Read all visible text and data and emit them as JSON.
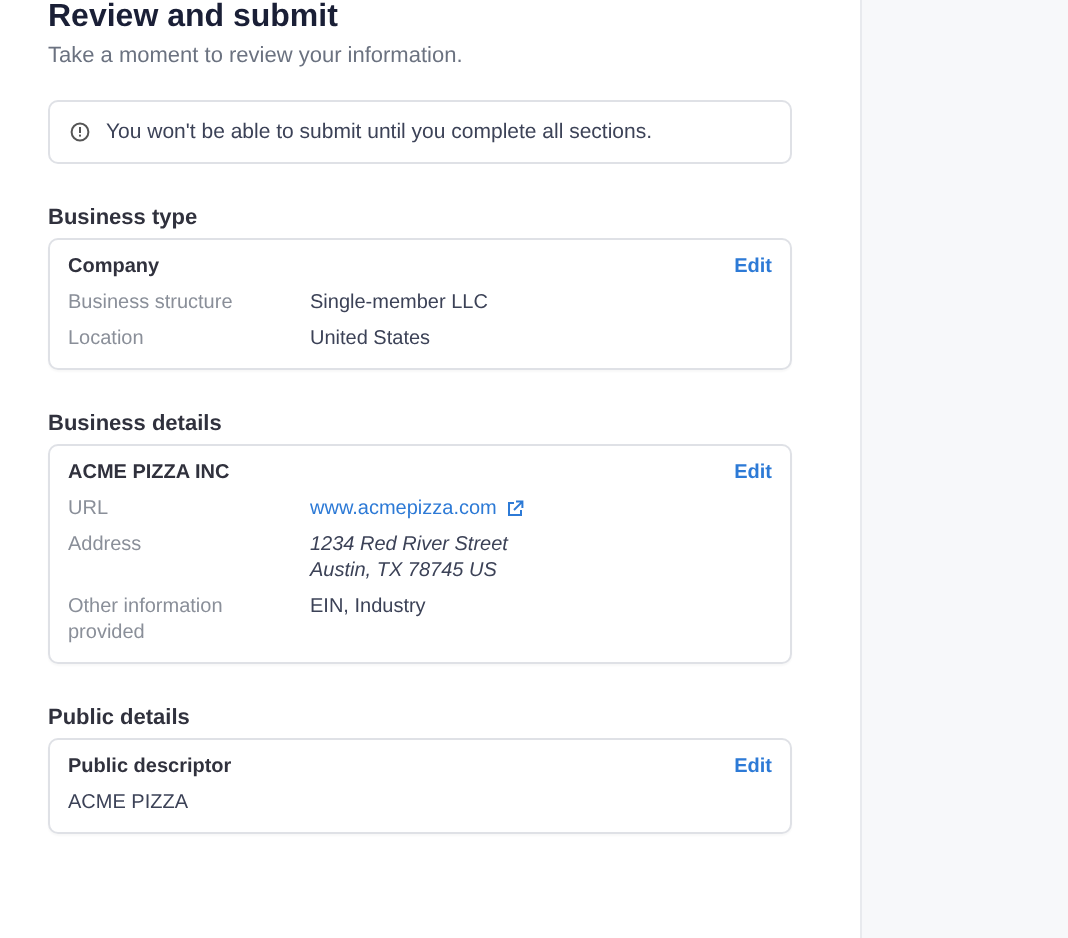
{
  "title": "Review and submit",
  "subtitle": "Take a moment to review your information.",
  "notice": {
    "text": "You won't be able to submit until you complete all sections."
  },
  "sections": [
    {
      "heading": "Business type",
      "card": {
        "title": "Company",
        "action": "Edit",
        "rows": [
          {
            "kind": "text",
            "label": "Business structure",
            "value": "Single-member LLC"
          },
          {
            "kind": "text",
            "label": "Location",
            "value": "United States"
          }
        ]
      }
    },
    {
      "heading": "Business details",
      "card": {
        "title": "ACME PIZZA INC",
        "action": "Edit",
        "rows": [
          {
            "kind": "link",
            "label": "URL",
            "value": "www.acmepizza.com"
          },
          {
            "kind": "address",
            "label": "Address",
            "lines": [
              "1234 Red River Street",
              "Austin, TX 78745 US"
            ]
          },
          {
            "kind": "text",
            "label": "Other information provided",
            "value": "EIN, Industry"
          }
        ]
      }
    },
    {
      "heading": "Public details",
      "card": {
        "title": "Public descriptor",
        "action": "Edit",
        "rows": [
          {
            "kind": "plain",
            "value": "ACME PIZZA"
          }
        ]
      }
    }
  ]
}
